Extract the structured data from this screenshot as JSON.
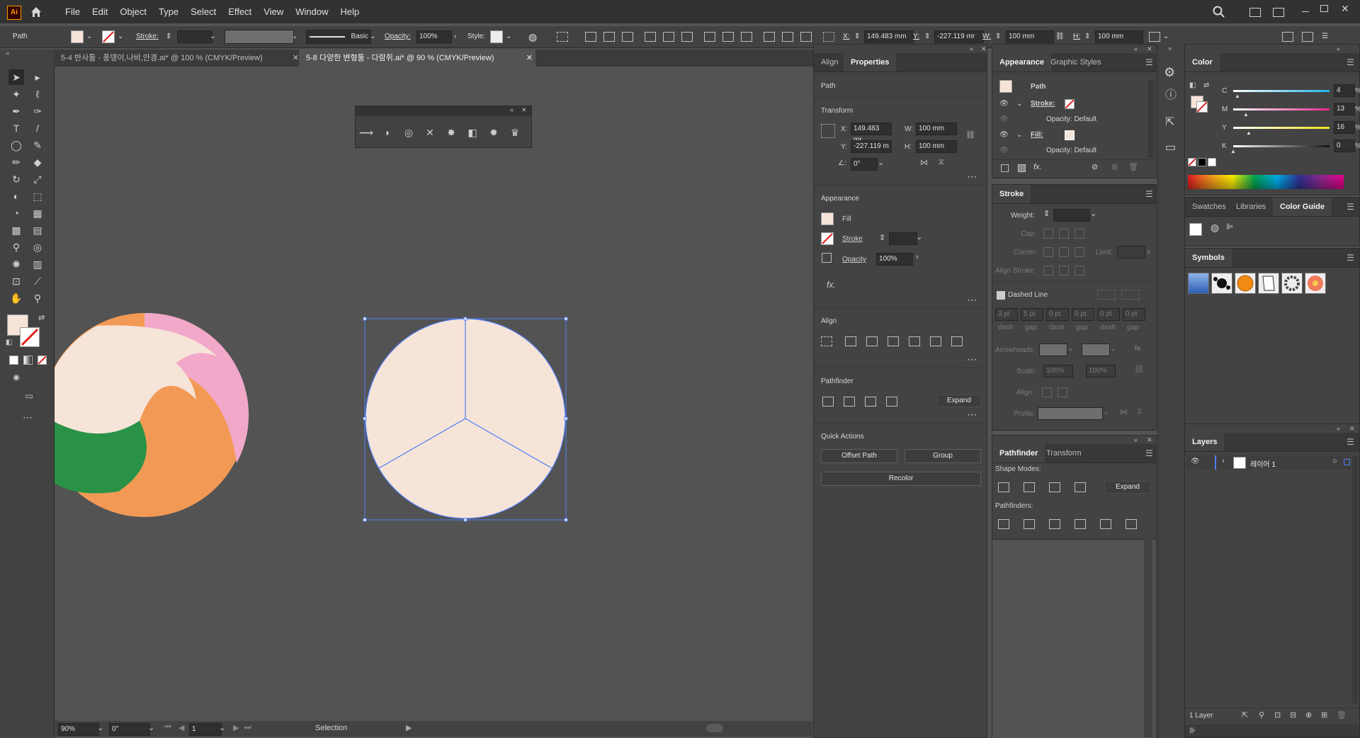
{
  "app": {
    "logo": "Ai",
    "home_icon": "home-icon"
  },
  "menu": [
    "File",
    "Edit",
    "Object",
    "Type",
    "Select",
    "Effect",
    "View",
    "Window",
    "Help"
  ],
  "control_bar": {
    "selection_type": "Path",
    "stroke_label": "Stroke:",
    "brush": "Basic",
    "opacity_label": "Opacity:",
    "opacity_value": "100%",
    "style_label": "Style:",
    "x_label": "X:",
    "x_value": "149.483 mm",
    "y_label": "Y:",
    "y_value": "-227.119 mr",
    "w_label": "W:",
    "w_value": "100 mm",
    "h_label": "H:",
    "h_value": "100 mm"
  },
  "doc_tabs": [
    {
      "label": "5-4 반사툴 - 풍뎅이,나비,안경.ai* @ 100 % (CMYK/Preview)",
      "active": false
    },
    {
      "label": "5-8 다양한 변형툴 - 다람쥐.ai* @ 90 % (CMYK/Preview)",
      "active": true
    }
  ],
  "status_bar": {
    "zoom": "90%",
    "rotation": "0°",
    "artboard": "1",
    "tool": "Selection"
  },
  "properties_panel": {
    "tabs": [
      "Align",
      "Properties"
    ],
    "object_type": "Path",
    "transform": {
      "title": "Transform",
      "x": "149.483 mr",
      "y": "-227.119 m",
      "w": "100 mm",
      "h": "100 mm",
      "angle": "0°"
    },
    "appearance": {
      "title": "Appearance",
      "fill": "Fill",
      "stroke": "Stroke",
      "opacity": "Opacity",
      "opacity_value": "100%",
      "fx": "fx."
    },
    "align": {
      "title": "Align"
    },
    "pathfinder": {
      "title": "Pathfinder",
      "expand": "Expand"
    },
    "quick_actions": {
      "title": "Quick Actions",
      "offset_path": "Offset Path",
      "group": "Group",
      "recolor": "Recolor"
    }
  },
  "appearance_panel": {
    "tabs": [
      "Appearance",
      "Graphic Styles"
    ],
    "title": "Path",
    "rows": [
      "Stroke:",
      "Opacity: Default",
      "Fill:",
      "Opacity: Default"
    ]
  },
  "stroke_panel": {
    "title": "Stroke",
    "weight": "Weight:",
    "cap": "Cap:",
    "corner": "Corner:",
    "limit": "Limit:",
    "x": "x",
    "align_stroke": "Align Stroke:",
    "dashed_line": "Dashed Line",
    "dash_values": [
      "3 pt",
      "5 pt",
      "0 pt",
      "0 pt",
      "0 pt",
      "0 pt"
    ],
    "dash_labels": [
      "dash",
      "gap",
      "dash",
      "gap",
      "dash",
      "gap"
    ],
    "arrowheads": "Arrowheads:",
    "scale": "Scale:",
    "scale1": "100%",
    "scale2": "100%",
    "align": "Align:",
    "profile": "Profile:"
  },
  "pathfinder_panel": {
    "tabs": [
      "Pathfinder",
      "Transform"
    ],
    "shape_modes": "Shape Modes:",
    "expand": "Expand",
    "pathfinders": "Pathfinders:"
  },
  "color_panel": {
    "title": "Color",
    "channels": [
      {
        "name": "C",
        "value": "4",
        "pct": 4,
        "color": "#1fb5e6"
      },
      {
        "name": "M",
        "value": "13",
        "pct": 13,
        "color": "#e6288c"
      },
      {
        "name": "Y",
        "value": "16",
        "pct": 16,
        "color": "#f0e21e"
      },
      {
        "name": "K",
        "value": "0",
        "pct": 0,
        "color": "#8a8a8a"
      }
    ],
    "percent": "%"
  },
  "swatches_panel": {
    "tabs": [
      "Swatches",
      "Libraries",
      "Color Guide"
    ]
  },
  "symbols_panel": {
    "title": "Symbols"
  },
  "layers_panel": {
    "title": "Layers",
    "layer_name": "레이어 1",
    "footer": "1 Layer"
  },
  "colors": {
    "fill": "#f6e4d9",
    "selection": "#4f7ff6",
    "green": "#2a9246",
    "orange": "#f29a55",
    "pink": "#f2a8c8"
  }
}
